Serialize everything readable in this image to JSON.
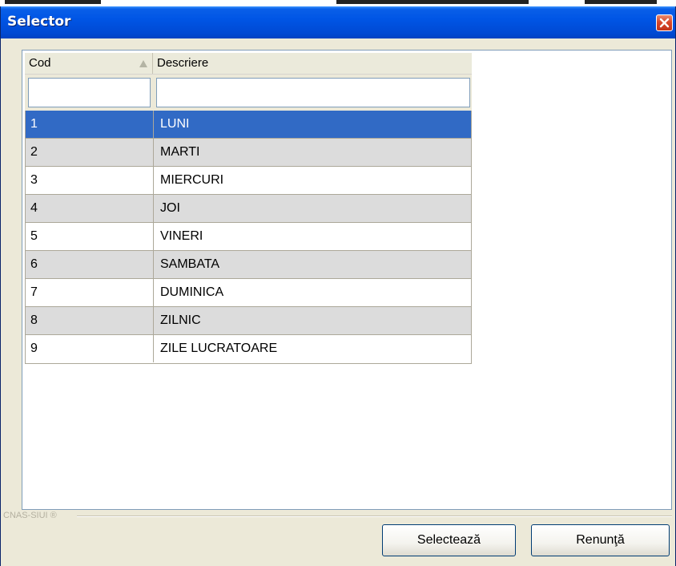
{
  "window": {
    "title": "Selector"
  },
  "grid": {
    "columns": [
      {
        "label": "Cod"
      },
      {
        "label": "Descriere"
      }
    ],
    "filters": {
      "cod_value": "",
      "descriere_value": ""
    },
    "selected_index": 0,
    "rows": [
      {
        "cod": "1",
        "descriere": "LUNI"
      },
      {
        "cod": "2",
        "descriere": "MARTI"
      },
      {
        "cod": "3",
        "descriere": "MIERCURI"
      },
      {
        "cod": "4",
        "descriere": "JOI"
      },
      {
        "cod": "5",
        "descriere": "VINERI"
      },
      {
        "cod": "6",
        "descriere": "SAMBATA"
      },
      {
        "cod": "7",
        "descriere": "DUMINICA"
      },
      {
        "cod": "8",
        "descriere": "ZILNIC"
      },
      {
        "cod": "9",
        "descriere": "ZILE LUCRATOARE"
      }
    ]
  },
  "footer": {
    "brand": "CNAS-SIUI ®",
    "select_label": "Selectează",
    "cancel_label": "Renunţă"
  },
  "colors": {
    "titlebar": "#0055e5",
    "selection": "#316ac5",
    "alt_row": "#dcdcdc",
    "dialog_bg": "#ece9d8"
  },
  "icons": {
    "close": "close-icon",
    "sort": "sort-ascending-icon"
  }
}
